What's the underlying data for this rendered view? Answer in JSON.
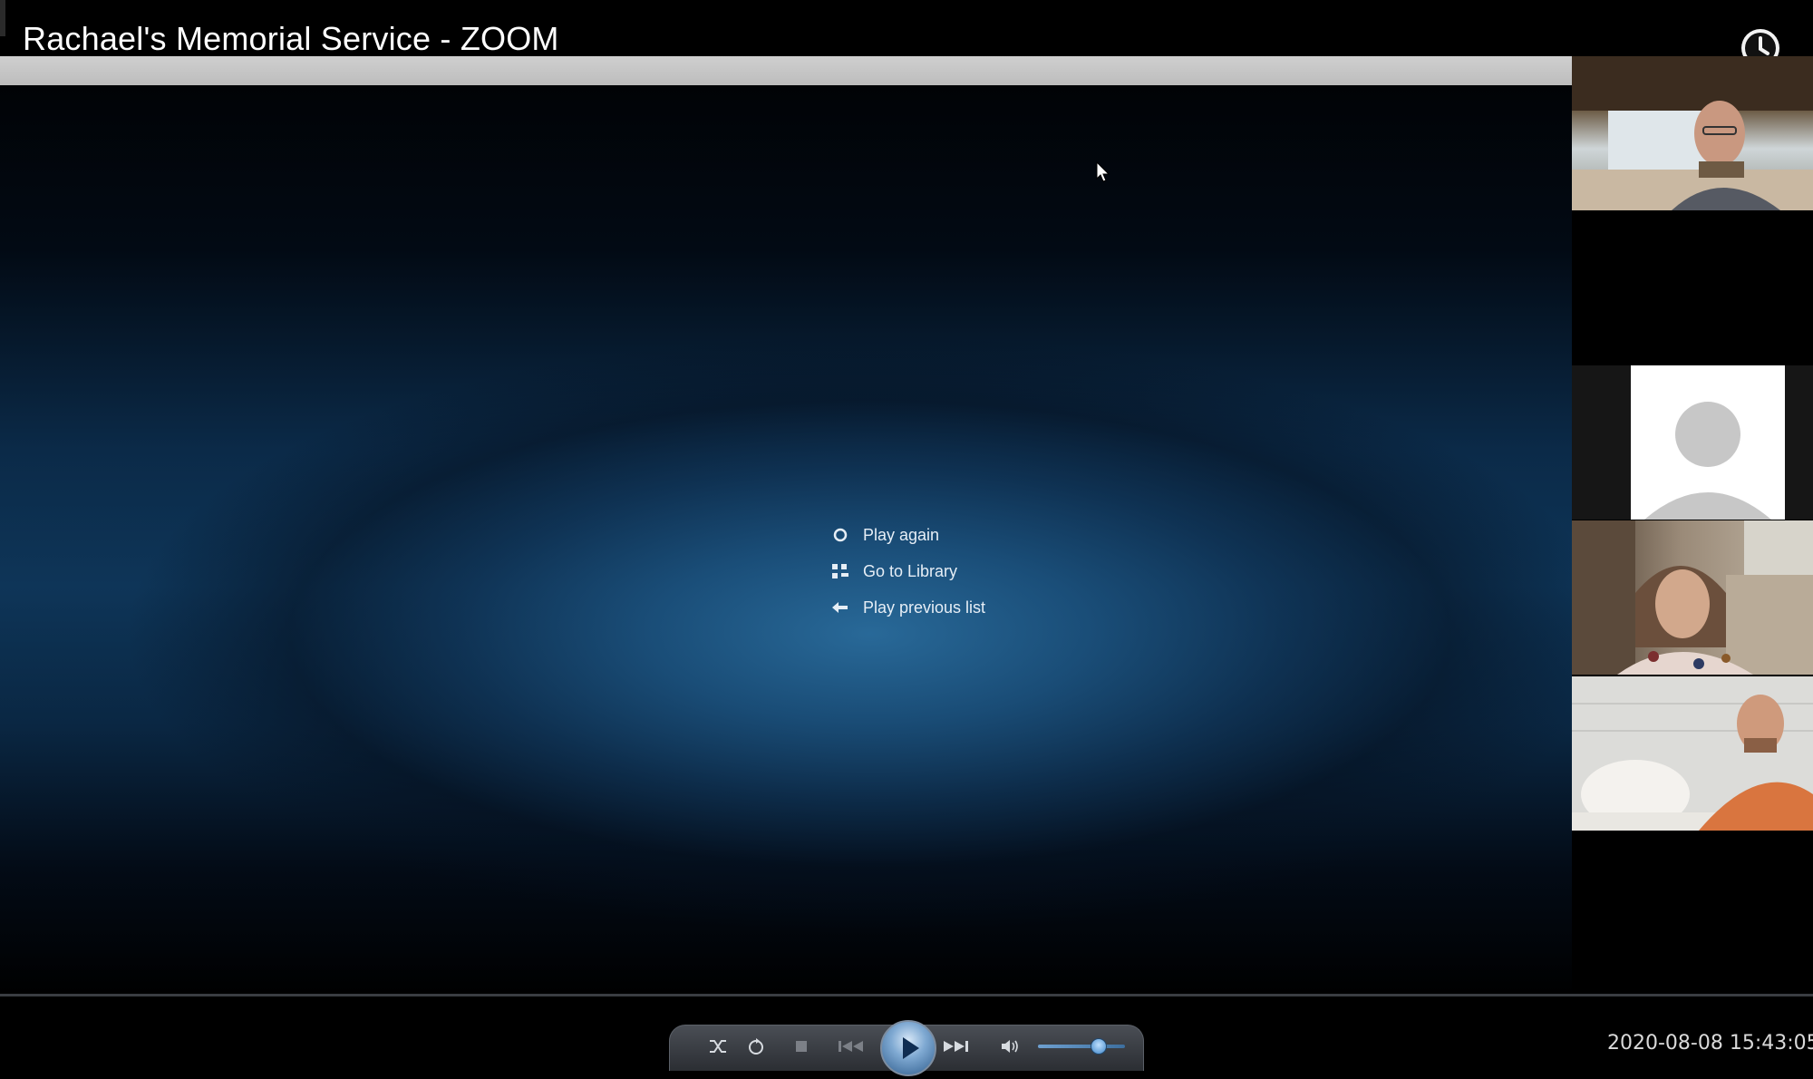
{
  "window": {
    "title": "Rachael's Memorial Service - ZOOM",
    "clock_icon": "clock-icon"
  },
  "player_end_menu": {
    "items": [
      {
        "label": "Play again",
        "icon": "replay-icon"
      },
      {
        "label": "Go to Library",
        "icon": "library-grid-icon"
      },
      {
        "label": "Play previous list",
        "icon": "back-arrow-icon"
      }
    ]
  },
  "playback_controls": {
    "buttons": [
      "shuffle-icon",
      "repeat-icon",
      "stop-icon",
      "previous-icon",
      "play-icon",
      "next-icon",
      "volume-icon"
    ],
    "volume_level": 0.7
  },
  "timestamp": "2020-08-08  15:43:05",
  "participants": [
    {
      "tile": "participant-video-1",
      "type": "video"
    },
    {
      "tile": "participant-avatar-placeholder",
      "type": "no-video"
    },
    {
      "tile": "participant-video-2",
      "type": "video"
    },
    {
      "tile": "participant-video-3",
      "type": "video"
    }
  ],
  "colors": {
    "background": "#000000",
    "player_glow": "#2a6c9c",
    "menu_text": "#e6eef6",
    "timestamp_text": "#d9d9d9"
  }
}
